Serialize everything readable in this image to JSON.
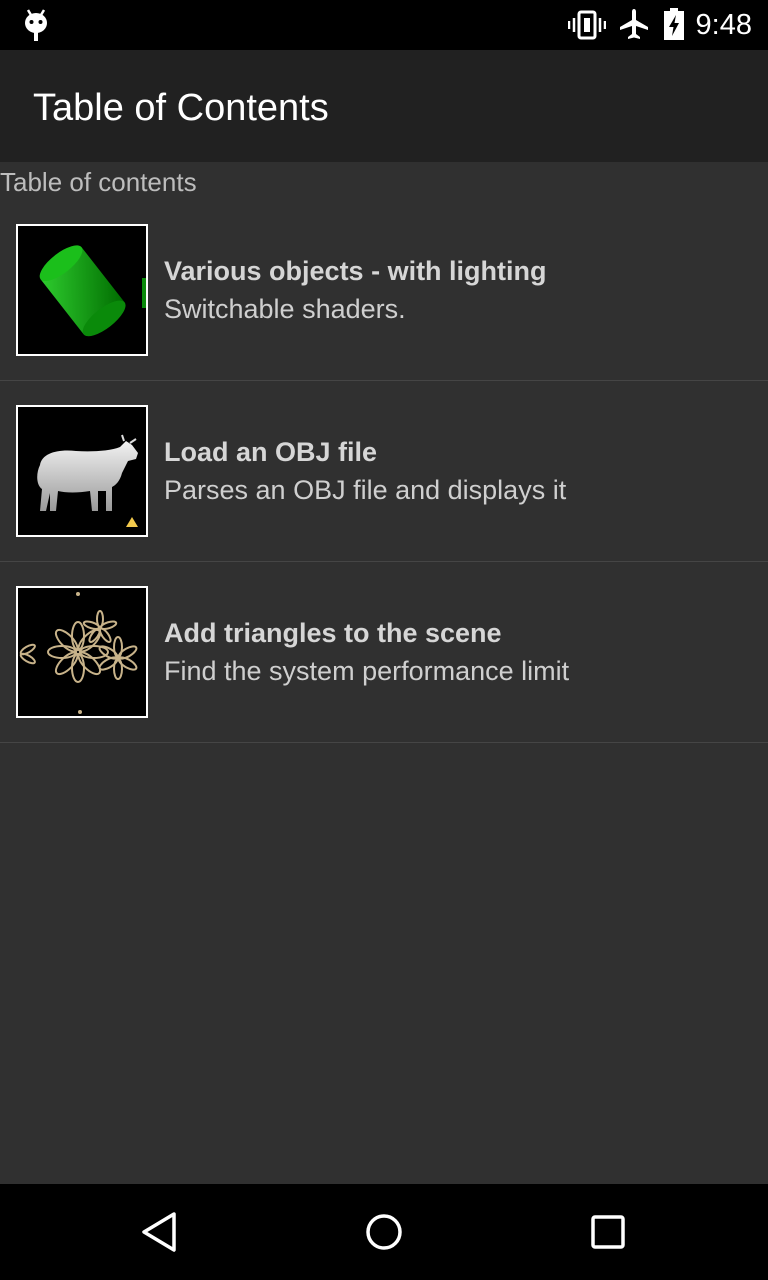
{
  "status_bar": {
    "time": "9:48",
    "icons": [
      "debug-icon",
      "vibrate-icon",
      "airplane-mode-icon",
      "battery-charging-icon"
    ]
  },
  "app_bar": {
    "title": "Table of Contents"
  },
  "content": {
    "section_header": "Table of contents",
    "items": [
      {
        "title": "Various objects - with lighting",
        "subtitle": "Switchable shaders.",
        "thumbnail": "green-cylinder-thumbnail"
      },
      {
        "title": "Load an OBJ file",
        "subtitle": "Parses an OBJ file and displays it",
        "thumbnail": "cow-model-thumbnail"
      },
      {
        "title": "Add triangles to the scene",
        "subtitle": "Find the system performance limit",
        "thumbnail": "flower-triangles-thumbnail"
      }
    ]
  },
  "nav_bar": {
    "buttons": [
      "back-icon",
      "home-icon",
      "recents-icon"
    ]
  },
  "colors": {
    "status_bar": "#000000",
    "app_bar": "#212121",
    "background": "#303030",
    "divider": "#454545"
  }
}
